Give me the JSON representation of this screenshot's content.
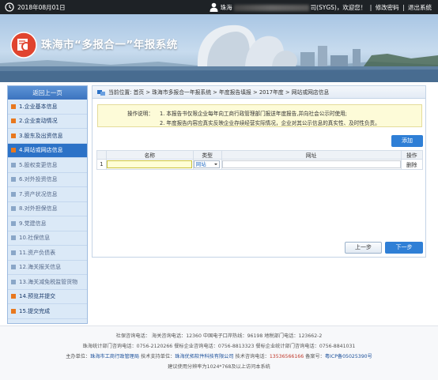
{
  "topbar": {
    "date": "2018年08月01日",
    "user_prefix": "珠海",
    "user_suffix": "司(SYGS)，欢迎您！",
    "change_password": "修改密码",
    "logout": "退出系统",
    "separator": "|"
  },
  "banner": {
    "title": "珠海市“多报合一”年报系统"
  },
  "sidebar": {
    "header": "返回上一页",
    "items": [
      {
        "label": "1.企业基本信息",
        "state": "done"
      },
      {
        "label": "2.企业变动情况",
        "state": "done"
      },
      {
        "label": "3.股东及出资信息",
        "state": "done"
      },
      {
        "label": "4.网站或网店信息",
        "state": "active"
      },
      {
        "label": "5.股权变更信息",
        "state": "todo"
      },
      {
        "label": "6.对外投资信息",
        "state": "todo"
      },
      {
        "label": "7.资产状况信息",
        "state": "todo"
      },
      {
        "label": "8.对外担保信息",
        "state": "todo"
      },
      {
        "label": "9.党建信息",
        "state": "todo"
      },
      {
        "label": "10.社保信息",
        "state": "todo"
      },
      {
        "label": "11.资产负债表",
        "state": "todo"
      },
      {
        "label": "12.海关报关信息",
        "state": "todo"
      },
      {
        "label": "13.海关减免税监管货物",
        "state": "todo"
      },
      {
        "label": "14.预览并提交",
        "state": "done"
      },
      {
        "label": "15.提交完成",
        "state": "done"
      }
    ]
  },
  "breadcrumb": {
    "text": "当前位置: 首页 > 珠海市多报合一年报系统 > 年度报告填报 > 2017年度 > 网站或网店信息"
  },
  "notice": {
    "label": "操作说明：",
    "line1": "1. 本报告书仅限企业每年向工商行政管理部门报送年度报告,并向社会公示时使用;",
    "line2": "2. 年度报告内容应真实反映企业存续经营实际情况，企业对其公示信息的真实性、及时性负责。"
  },
  "table": {
    "add_label": "添加",
    "headers": {
      "name": "名称",
      "type": "类型",
      "url": "网址",
      "action": "操作"
    },
    "rows": [
      {
        "index": "1",
        "name": "",
        "type": "网站",
        "url": "",
        "action": "删除"
      }
    ]
  },
  "buttons": {
    "prev": "上一步",
    "next": "下一步"
  },
  "footer": {
    "line1": "社保咨询电话： 海关咨询电话：12360 中国电子口岸热线：96198 地税部门电话：123662-2",
    "line2": "珠海统计部门咨询电话：0756-2120266 餐标企业咨询电话：0756-8813323 餐标企业统计部门咨询电话：0756-8841031",
    "line3_a": "主办单位：",
    "line3_b": "珠海市工商行政管理局",
    "line3_c": " 技术支持单位：",
    "line3_d": "珠海优拓软件科技有限公司",
    "line3_e": " 技术咨询电话：",
    "line3_f": "13536566166",
    "line3_g": " 备案号：",
    "line3_h": "粤ICP备05025390号",
    "line4": "建议使用分辨率为1024*768及以上访问本系统"
  },
  "colors": {
    "accent": "#2f7fd6",
    "topbar": "#1e2226",
    "sidebar_active": "#2c72c7",
    "done_marker": "#e8781e"
  }
}
